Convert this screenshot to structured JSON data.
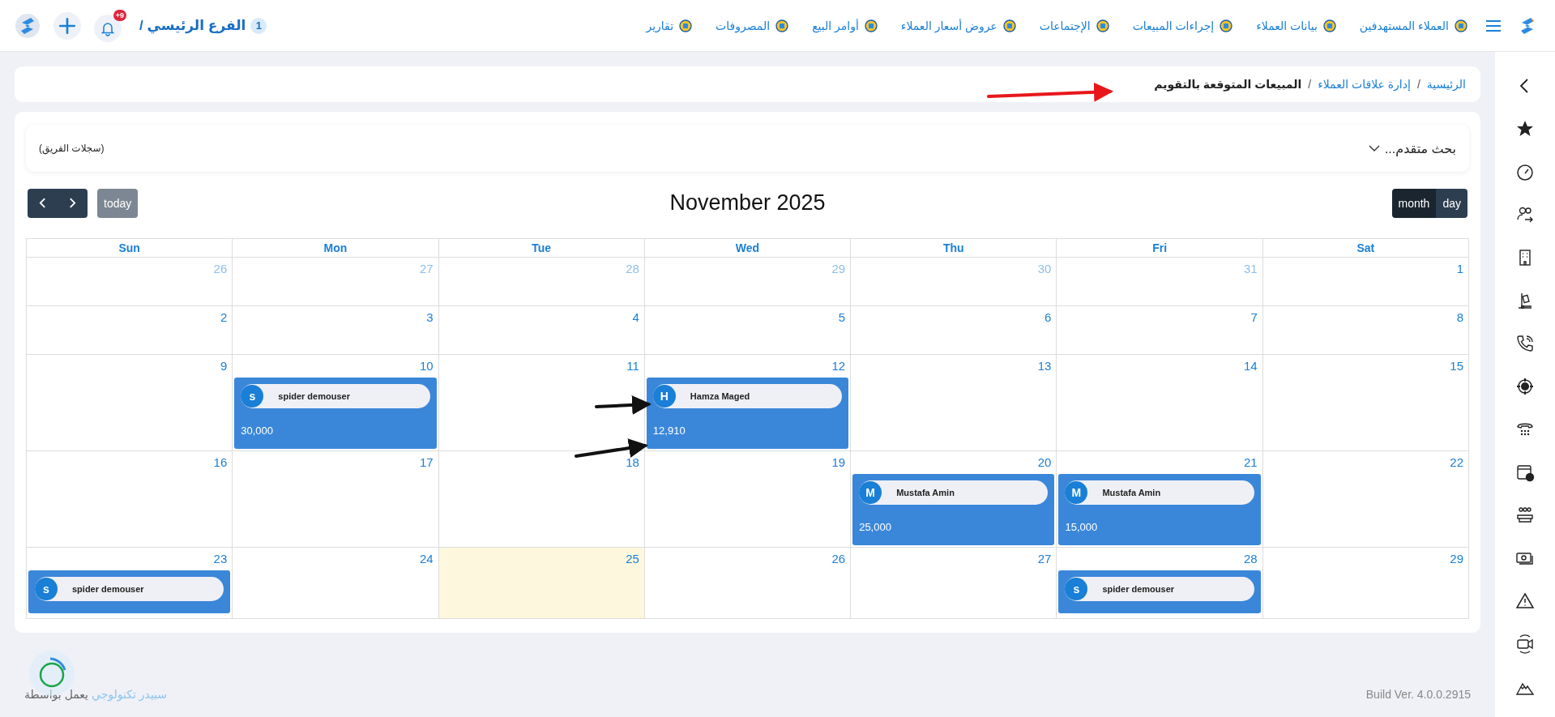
{
  "topbar": {
    "branch": {
      "count": "1",
      "label": "الفرع الرئيسي /"
    },
    "notifications": {
      "badge": "+9"
    },
    "nav": [
      {
        "label": "العملاء المستهدفين"
      },
      {
        "label": "بيانات العملاء"
      },
      {
        "label": "إجراءات المبيعات"
      },
      {
        "label": "الإجتماعات"
      },
      {
        "label": "عروض أسعار العملاء"
      },
      {
        "label": "أوامر البيع"
      },
      {
        "label": "المصروفات"
      },
      {
        "label": "تقارير"
      }
    ]
  },
  "breadcrumb": [
    {
      "kind": "link",
      "label": "الرئيسية"
    },
    {
      "kind": "separator",
      "label": "/"
    },
    {
      "kind": "link",
      "label": "إدارة علاقات العملاء"
    },
    {
      "kind": "separator",
      "label": "/"
    },
    {
      "kind": "current",
      "label": "المبيعات المتوقعة بالتقويم"
    }
  ],
  "search": {
    "label": "بحث متقدم...",
    "expanded": false,
    "scope": "(سجلات الفريق)"
  },
  "calendar": {
    "views": [
      {
        "label": "day",
        "selected": false
      },
      {
        "label": "month",
        "selected": true
      }
    ],
    "title": "November 2025",
    "today_button": {
      "label": "today",
      "disabled": true
    },
    "weekdays": [
      "Sat",
      "Fri",
      "Thu",
      "Wed",
      "Tue",
      "Mon",
      "Sun"
    ],
    "weeks": [
      [
        {
          "day": "1",
          "other_month": false
        },
        {
          "day": "31",
          "other_month": true
        },
        {
          "day": "30",
          "other_month": true
        },
        {
          "day": "29",
          "other_month": true
        },
        {
          "day": "28",
          "other_month": true
        },
        {
          "day": "27",
          "other_month": true
        },
        {
          "day": "26",
          "other_month": true
        }
      ],
      [
        {
          "day": "8",
          "other_month": false
        },
        {
          "day": "7",
          "other_month": false
        },
        {
          "day": "6",
          "other_month": false
        },
        {
          "day": "5",
          "other_month": false
        },
        {
          "day": "4",
          "other_month": false
        },
        {
          "day": "3",
          "other_month": false
        },
        {
          "day": "2",
          "other_month": false
        }
      ],
      [
        {
          "day": "15",
          "other_month": false
        },
        {
          "day": "14",
          "other_month": false
        },
        {
          "day": "13",
          "other_month": false
        },
        {
          "day": "12",
          "other_month": false,
          "events": [
            {
              "initial": "H",
              "name": "Hamza Maged",
              "amount": "12,910"
            }
          ]
        },
        {
          "day": "11",
          "other_month": false
        },
        {
          "day": "10",
          "other_month": false,
          "events": [
            {
              "initial": "s",
              "name": "spider demouser",
              "amount": "30,000"
            }
          ]
        },
        {
          "day": "9",
          "other_month": false
        }
      ],
      [
        {
          "day": "22",
          "other_month": false
        },
        {
          "day": "21",
          "other_month": false,
          "events": [
            {
              "initial": "M",
              "name": "Mustafa Amin",
              "amount": "15,000"
            }
          ]
        },
        {
          "day": "20",
          "other_month": false,
          "events": [
            {
              "initial": "M",
              "name": "Mustafa Amin",
              "amount": "25,000"
            }
          ]
        },
        {
          "day": "19",
          "other_month": false
        },
        {
          "day": "18",
          "other_month": false
        },
        {
          "day": "17",
          "other_month": false
        },
        {
          "day": "16",
          "other_month": false
        }
      ],
      [
        {
          "day": "29",
          "other_month": false
        },
        {
          "day": "28",
          "other_month": false,
          "events": [
            {
              "initial": "s",
              "name": "spider demouser"
            }
          ]
        },
        {
          "day": "27",
          "other_month": false
        },
        {
          "day": "26",
          "other_month": false
        },
        {
          "day": "25",
          "other_month": false,
          "today": true
        },
        {
          "day": "24",
          "other_month": false
        },
        {
          "day": "23",
          "other_month": false,
          "events": [
            {
              "initial": "s",
              "name": "spider demouser"
            }
          ]
        }
      ]
    ]
  },
  "footer": {
    "powered_by": "يعمل بواسطة",
    "company": "سبيدر تكنولوجي",
    "version": "Build Ver. 4.0.0.2915"
  }
}
